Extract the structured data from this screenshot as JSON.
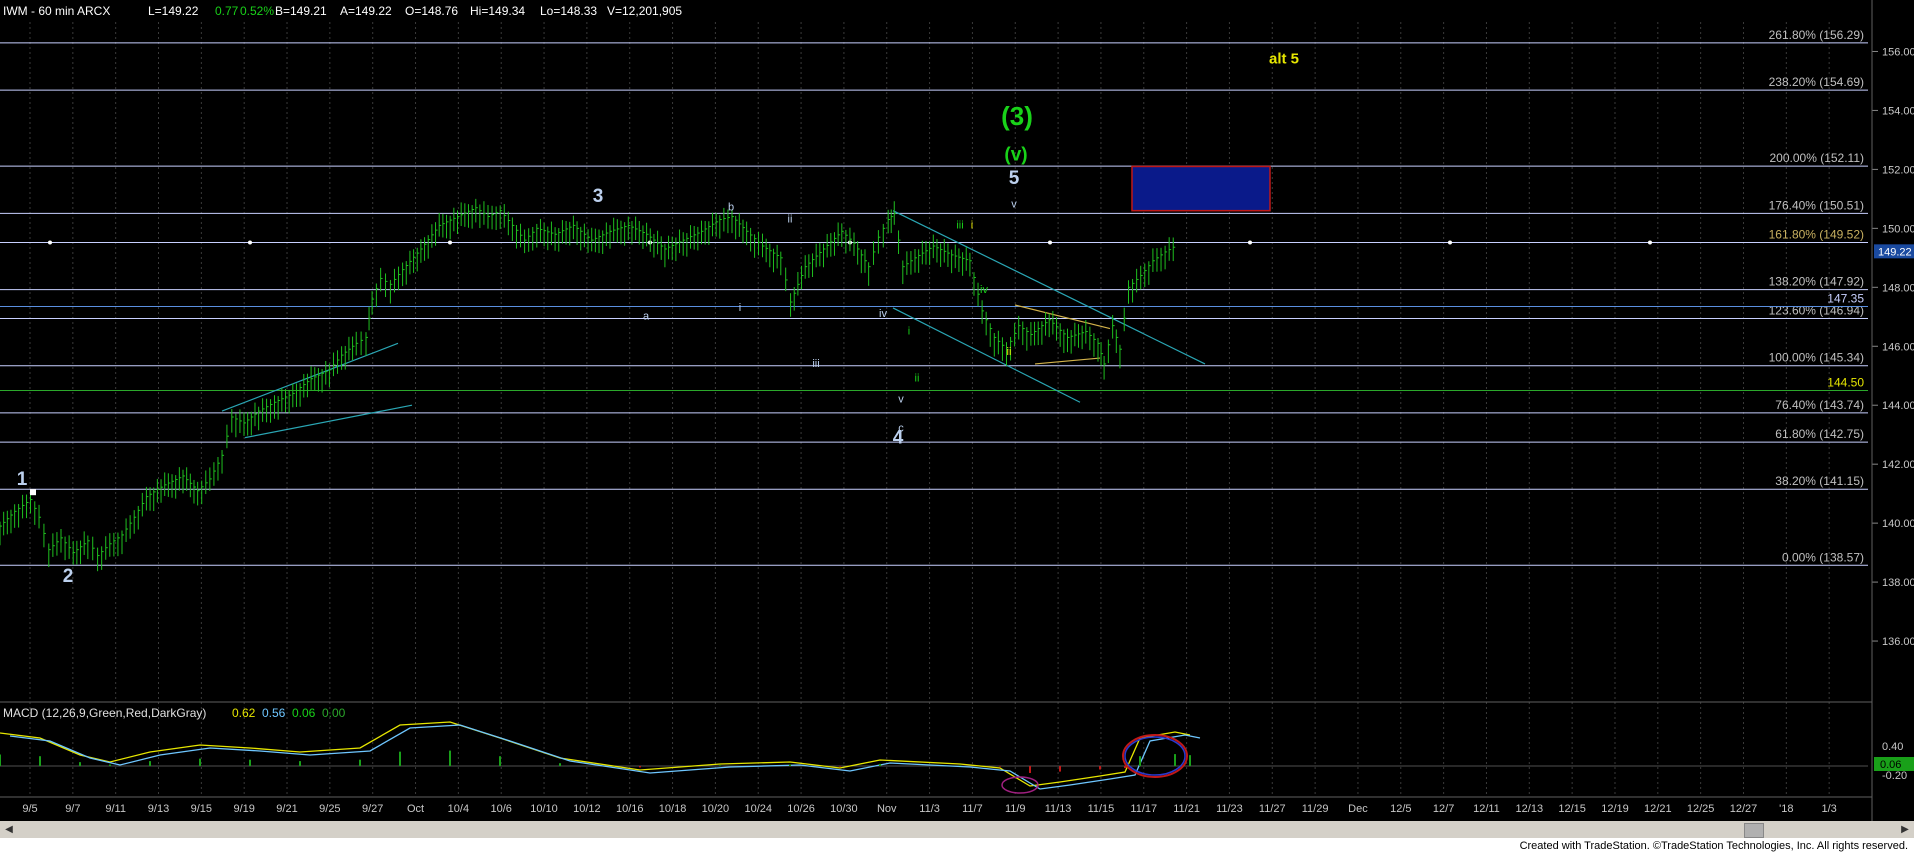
{
  "header": {
    "symbol_line": "IWM - 60 min  ARCX",
    "last": "L=149.22",
    "change": "0.77",
    "pct": "0.52%",
    "bid": "B=149.21",
    "ask": "A=149.22",
    "open": "O=148.76",
    "high": "Hi=149.34",
    "low": "Lo=148.33",
    "volume": "V=12,201,905"
  },
  "colors": {
    "price_bars": "#1fbf1f",
    "fib_line": "#c8d0ff",
    "fib_label": "#c0c0c0",
    "fib_161_label": "#c8b060",
    "wave_primary": "#bcd0ee",
    "wave_green": "#19d219",
    "wave_yellow": "#e6e600",
    "channel": "#2aa6b4",
    "target_box_fill": "#0a1a8a",
    "target_box_border": "#c01818"
  },
  "chart_data": {
    "type": "ohlc",
    "symbol": "IWM",
    "interval": "60 min",
    "ylim": [
      134.0,
      157.0
    ],
    "y_ticks": [
      "156.00",
      "154.00",
      "152.00",
      "150.00",
      "148.00",
      "146.00",
      "144.00",
      "142.00",
      "140.00",
      "138.00",
      "136.00"
    ],
    "last_price_tag": "149.22",
    "x_labels": [
      "9/5",
      "9/7",
      "9/11",
      "9/13",
      "9/15",
      "9/19",
      "9/21",
      "9/25",
      "9/27",
      "Oct",
      "10/4",
      "10/6",
      "10/10",
      "10/12",
      "10/16",
      "10/18",
      "10/20",
      "10/24",
      "10/26",
      "10/30",
      "Nov",
      "11/3",
      "11/7",
      "11/9",
      "11/13",
      "11/15",
      "11/17",
      "11/21",
      "11/23",
      "11/27",
      "11/29",
      "Dec",
      "12/5",
      "12/7",
      "12/11",
      "12/13",
      "12/15",
      "12/19",
      "12/21",
      "12/25",
      "12/27",
      "'18",
      "1/3"
    ],
    "price_path": [
      [
        0,
        139.8
      ],
      [
        12,
        140.3
      ],
      [
        25,
        140.7
      ],
      [
        32,
        140.1
      ],
      [
        40,
        139.0
      ],
      [
        50,
        139.4
      ],
      [
        60,
        138.9
      ],
      [
        72,
        139.3
      ],
      [
        80,
        138.8
      ],
      [
        90,
        139.2
      ],
      [
        100,
        139.5
      ],
      [
        110,
        140.1
      ],
      [
        120,
        140.8
      ],
      [
        135,
        141.2
      ],
      [
        150,
        141.5
      ],
      [
        162,
        141.0
      ],
      [
        172,
        141.4
      ],
      [
        182,
        142.2
      ],
      [
        190,
        143.5
      ],
      [
        200,
        143.3
      ],
      [
        212,
        143.7
      ],
      [
        225,
        144.0
      ],
      [
        240,
        144.3
      ],
      [
        255,
        144.8
      ],
      [
        270,
        145.1
      ],
      [
        280,
        145.6
      ],
      [
        292,
        146.0
      ],
      [
        300,
        146.2
      ],
      [
        305,
        147.5
      ],
      [
        312,
        148.2
      ],
      [
        320,
        148.0
      ],
      [
        330,
        148.5
      ],
      [
        345,
        149.2
      ],
      [
        360,
        150.0
      ],
      [
        375,
        150.3
      ],
      [
        390,
        150.6
      ],
      [
        400,
        150.3
      ],
      [
        410,
        150.5
      ],
      [
        420,
        150.0
      ],
      [
        430,
        149.5
      ],
      [
        440,
        149.9
      ],
      [
        455,
        149.7
      ],
      [
        470,
        150.0
      ],
      [
        485,
        149.5
      ],
      [
        500,
        149.8
      ],
      [
        515,
        150.0
      ],
      [
        530,
        149.7
      ],
      [
        545,
        149.2
      ],
      [
        560,
        149.5
      ],
      [
        575,
        149.8
      ],
      [
        590,
        150.2
      ],
      [
        600,
        150.3
      ],
      [
        612,
        149.8
      ],
      [
        625,
        149.3
      ],
      [
        640,
        148.9
      ],
      [
        648,
        147.4
      ],
      [
        660,
        148.6
      ],
      [
        675,
        149.2
      ],
      [
        690,
        149.8
      ],
      [
        700,
        149.4
      ],
      [
        712,
        148.6
      ],
      [
        720,
        149.6
      ],
      [
        728,
        150.2
      ],
      [
        733,
        150.4
      ],
      [
        740,
        148.6
      ],
      [
        750,
        148.9
      ],
      [
        765,
        149.3
      ],
      [
        780,
        149.0
      ],
      [
        795,
        148.8
      ],
      [
        805,
        147.1
      ],
      [
        815,
        146.2
      ],
      [
        825,
        145.8
      ],
      [
        835,
        146.6
      ],
      [
        845,
        146.3
      ],
      [
        860,
        146.8
      ],
      [
        875,
        146.2
      ],
      [
        890,
        146.4
      ],
      [
        900,
        146.0
      ],
      [
        905,
        145.3
      ],
      [
        912,
        146.6
      ],
      [
        918,
        145.8
      ],
      [
        925,
        147.9
      ],
      [
        935,
        148.3
      ],
      [
        945,
        148.8
      ],
      [
        955,
        149.1
      ],
      [
        965,
        149.34
      ]
    ],
    "fib_levels": [
      {
        "label": "261.80% (156.29)",
        "price": 156.29
      },
      {
        "label": "238.20% (154.69)",
        "price": 154.69
      },
      {
        "label": "200.00% (152.11)",
        "price": 152.11
      },
      {
        "label": "176.40% (150.51)",
        "price": 150.51
      },
      {
        "label": "161.80% (149.52)",
        "price": 149.52
      },
      {
        "label": "138.20% (147.92)",
        "price": 147.92
      },
      {
        "label": "123.60% (146.94)",
        "price": 146.94
      },
      {
        "label": "100.00% (145.34)",
        "price": 145.34
      },
      {
        "label": "76.40% (143.74)",
        "price": 143.74
      },
      {
        "label": "61.80% (142.75)",
        "price": 142.75
      },
      {
        "label": "38.20% (141.15)",
        "price": 141.15
      },
      {
        "label": "0.00% (138.57)",
        "price": 138.57
      }
    ],
    "support_levels": [
      {
        "label": "147.35",
        "price": 147.35
      },
      {
        "label": "144.50",
        "price": 144.5
      }
    ],
    "target_box": {
      "price_top": 152.1,
      "price_bottom": 150.6
    },
    "wave_labels": [
      {
        "text": "1",
        "price": 141.3,
        "bar": 22,
        "color": "primary",
        "size": "big"
      },
      {
        "text": "2",
        "price": 138.0,
        "bar": 68,
        "color": "primary",
        "size": "big"
      },
      {
        "text": "3",
        "price": 150.9,
        "bar": 598,
        "color": "primary",
        "size": "big"
      },
      {
        "text": "4",
        "price": 142.7,
        "bar": 898,
        "color": "primary",
        "size": "big"
      },
      {
        "text": "5",
        "price": 151.5,
        "bar": 1014,
        "color": "primary",
        "size": "big"
      },
      {
        "text": "v",
        "price": 150.7,
        "bar": 1014,
        "color": "primary",
        "size": "small"
      },
      {
        "text": "(v)",
        "price": 152.3,
        "bar": 1016,
        "color": "green",
        "size": "big"
      },
      {
        "text": "(3)",
        "price": 153.5,
        "bar": 1017,
        "color": "green",
        "size": "huge"
      },
      {
        "text": "alt 5",
        "price": 155.6,
        "bar": 1284,
        "color": "yellow",
        "size": "mid"
      },
      {
        "text": "a",
        "price": 146.9,
        "bar": 646,
        "color": "primary",
        "size": "small"
      },
      {
        "text": "b",
        "price": 150.6,
        "bar": 731,
        "color": "primary",
        "size": "small"
      },
      {
        "text": "c",
        "price": 143.1,
        "bar": 901,
        "color": "primary",
        "size": "small"
      },
      {
        "text": "i",
        "price": 147.2,
        "bar": 740,
        "color": "primary",
        "size": "small"
      },
      {
        "text": "ii",
        "price": 150.2,
        "bar": 790,
        "color": "primary",
        "size": "small"
      },
      {
        "text": "iii",
        "price": 145.3,
        "bar": 816,
        "color": "primary",
        "size": "small"
      },
      {
        "text": "iv",
        "price": 147.0,
        "bar": 883,
        "color": "primary",
        "size": "small"
      },
      {
        "text": "v",
        "price": 144.1,
        "bar": 901,
        "color": "primary",
        "size": "small"
      },
      {
        "text": "i",
        "price": 146.4,
        "bar": 909,
        "color": "green",
        "size": "small"
      },
      {
        "text": "ii",
        "price": 144.8,
        "bar": 917,
        "color": "green",
        "size": "small"
      },
      {
        "text": "iii",
        "price": 150.0,
        "bar": 960,
        "color": "green",
        "size": "small"
      },
      {
        "text": "i",
        "price": 150.0,
        "bar": 972,
        "color": "yellow",
        "size": "small"
      },
      {
        "text": "iv",
        "price": 147.8,
        "bar": 984,
        "color": "green",
        "size": "small"
      },
      {
        "text": "ii",
        "price": 145.7,
        "bar": 1009,
        "color": "yellow",
        "size": "small"
      }
    ],
    "macd": {
      "label": "MACD (12,26,9,Green,Red,DarkGray)",
      "values": [
        "0.62",
        "0.56",
        "0.06",
        "0.00"
      ],
      "ticks": [
        "0.40",
        "-0.20"
      ],
      "last_tag": "0.06"
    }
  },
  "footer": {
    "text": "Created with TradeStation. ©TradeStation Technologies, Inc. All rights reserved."
  }
}
